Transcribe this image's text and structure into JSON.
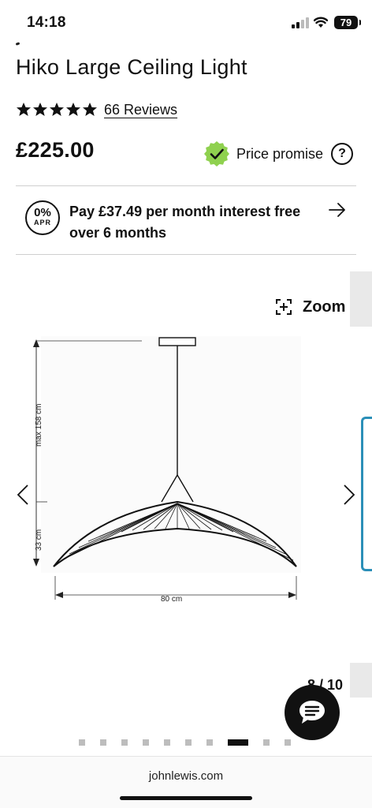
{
  "status_bar": {
    "time": "14:18",
    "battery": "79"
  },
  "product": {
    "title": "Hiko Large Ceiling Light",
    "rating_stars": 5,
    "reviews_label": "66 Reviews",
    "price": "£225.00",
    "price_promise_label": "Price promise",
    "help_symbol": "?"
  },
  "finance": {
    "apr_percent": "0%",
    "apr_label": "APR",
    "text": "Pay £37.49 per month interest free over 6 months"
  },
  "gallery": {
    "zoom_label": "Zoom",
    "counter": "8 / 10",
    "current_index": 8,
    "total_images": 10,
    "diagram": {
      "height_label": "max 158 cm",
      "shade_height_label": "33 cm",
      "width_label": "80 cm"
    }
  },
  "footer": {
    "domain": "johnlewis.com"
  },
  "colors": {
    "promise_green": "#8fd14f",
    "thumb_border": "#2b8fb8"
  },
  "icons": [
    "star-icon",
    "checkmark-badge-icon",
    "help-icon",
    "arrow-right-icon",
    "zoom-icon",
    "chevron-left-icon",
    "chevron-right-icon",
    "chat-icon"
  ]
}
